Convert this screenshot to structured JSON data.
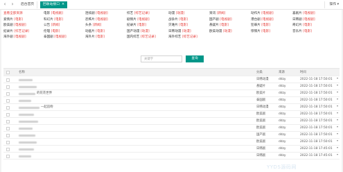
{
  "tabbar": {
    "back_icon": "chevron-left-icon",
    "forward_icon": "chevron-right-icon",
    "tabs": [
      {
        "label": "后台首页"
      },
      {
        "label": "回收站接口",
        "close": "×"
      }
    ],
    "ops_label": "操作 ▾"
  },
  "categories": [
    [
      "查看全部资源",
      "电影 [电视剧]",
      "连续剧 [电视剧]",
      "综艺 [综艺记录]",
      "动漫 [动漫]",
      "资讯 [新闻]",
      "动作片 [电视剧]",
      "喜剧片 [电视剧]"
    ],
    [
      "爱情片 [电影]",
      "科幻片 [电影]",
      "恐怖片 [电视剧]",
      "剧情片 [电视剧]",
      "战争片 [电影]",
      "国产剧 [电视剧]",
      "港台剧 [电视剧]",
      "日韩剧 [电视剧]"
    ],
    [
      "欧美剧 [电视剧]",
      "公告 [新闻]",
      "头条 [新闻]",
      "纪录片 [电影]",
      "灾难片 [电影]",
      "悬疑片 [电影]",
      "犯罪片 [电影]",
      "奇幻片 [电影]"
    ],
    [
      "纪录片 [综艺记录]",
      "伦理 [电影]",
      "动画片 [电影]",
      "国产动漫 [动漫]",
      "日韩动漫 [动漫]",
      "欧美动漫 [动漫]",
      "惊悚片 [电影]",
      "音乐片 [电影]"
    ],
    [
      "海外剧 [电视剧]",
      "泰国剧 [电视剧]",
      "海外片 [电影]",
      "国内综艺 [综艺记录]",
      "海外综艺 [综艺记录]"
    ]
  ],
  "search": {
    "placeholder": "关键字",
    "button_label": "查询"
  },
  "table": {
    "columns": [
      "名称",
      "分类",
      "来源",
      "时间"
    ],
    "rows": [
      {
        "name": "",
        "category": "日韩动漫",
        "source": "ddzy",
        "time": "2022-11-18 17:50:01"
      },
      {
        "name": "",
        "category": "悬疑片",
        "source": "ddzy",
        "time": "2022-11-18 17:50:01"
      },
      {
        "name": "的花花世界",
        "category": "欧美片",
        "source": "ddzy",
        "time": "2022-11-18 17:50:01"
      },
      {
        "name": "",
        "category": "泰国剧",
        "source": "ddzy",
        "time": "2022-11-18 17:50:01"
      },
      {
        "name": "一起追吻",
        "category": "日韩动漫",
        "source": "ddzy",
        "time": "2022-11-18 17:50:01"
      },
      {
        "name": "",
        "category": "欧美剧",
        "source": "ddzy",
        "time": "2022-11-18 17:50:01"
      },
      {
        "name": "",
        "category": "欧美剧",
        "source": "ddzy",
        "time": "2022-11-18 17:50:01"
      },
      {
        "name": "",
        "category": "欧美剧",
        "source": "ddzy",
        "time": "2022-11-18 17:50:01"
      },
      {
        "name": "",
        "category": "国产剧",
        "source": "ddzy",
        "time": "2022-11-18 17:50:01"
      },
      {
        "name": "",
        "category": "欧美剧",
        "source": "ddzy",
        "time": "2022-11-18 17:50:01"
      },
      {
        "name": "",
        "category": "日韩剧",
        "source": "ddzy",
        "time": "2022-11-18 17:45:01"
      },
      {
        "name": "",
        "category": "日韩剧",
        "source": "ddzy",
        "time": "2022-11-18 17:45:01"
      }
    ]
  },
  "watermark": "YYDS源码网"
}
